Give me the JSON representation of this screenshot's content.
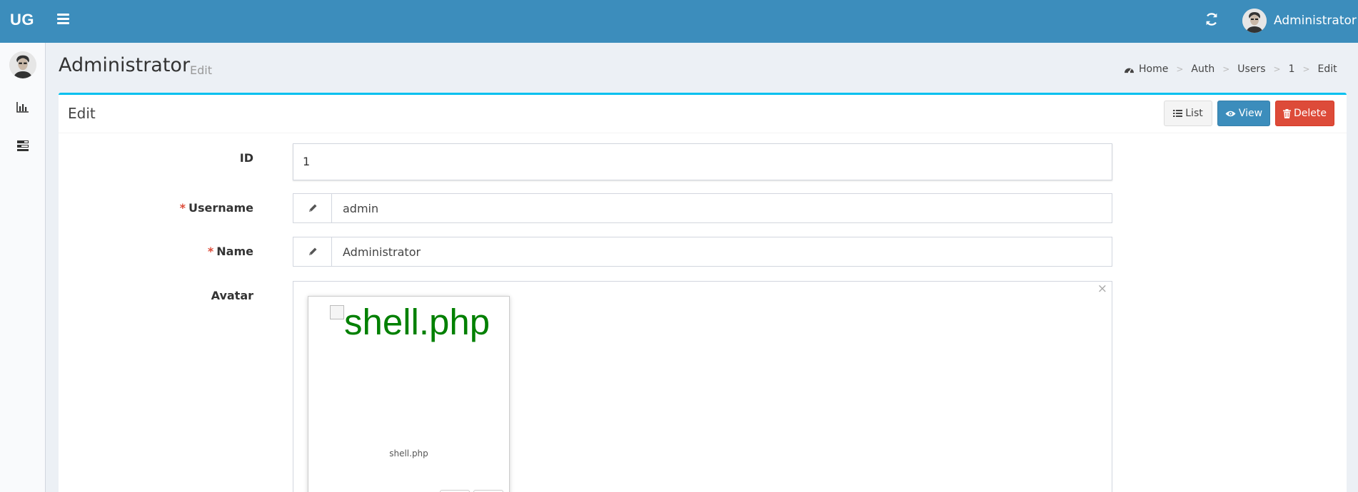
{
  "navbar": {
    "logo": "UG",
    "user_name": "Administrator"
  },
  "header": {
    "title": "Administrator",
    "subtitle": "Edit",
    "breadcrumb": [
      "Home",
      "Auth",
      "Users",
      "1",
      "Edit"
    ]
  },
  "box": {
    "title": "Edit",
    "buttons": {
      "list": "List",
      "view": "View",
      "delete": "Delete"
    }
  },
  "form": {
    "id": {
      "label": "ID",
      "value": "1"
    },
    "username": {
      "label": "Username",
      "value": "admin",
      "required_mark": "*"
    },
    "name": {
      "label": "Name",
      "value": "Administrator",
      "required_mark": "*"
    },
    "avatar": {
      "label": "Avatar",
      "close": "×",
      "image_alt": "shell.php",
      "caption": "shell.php"
    }
  },
  "colors": {
    "primary": "#3c8dbc",
    "danger": "#dd4b39",
    "info": "#00c0ef",
    "alt_text": "#008000"
  }
}
